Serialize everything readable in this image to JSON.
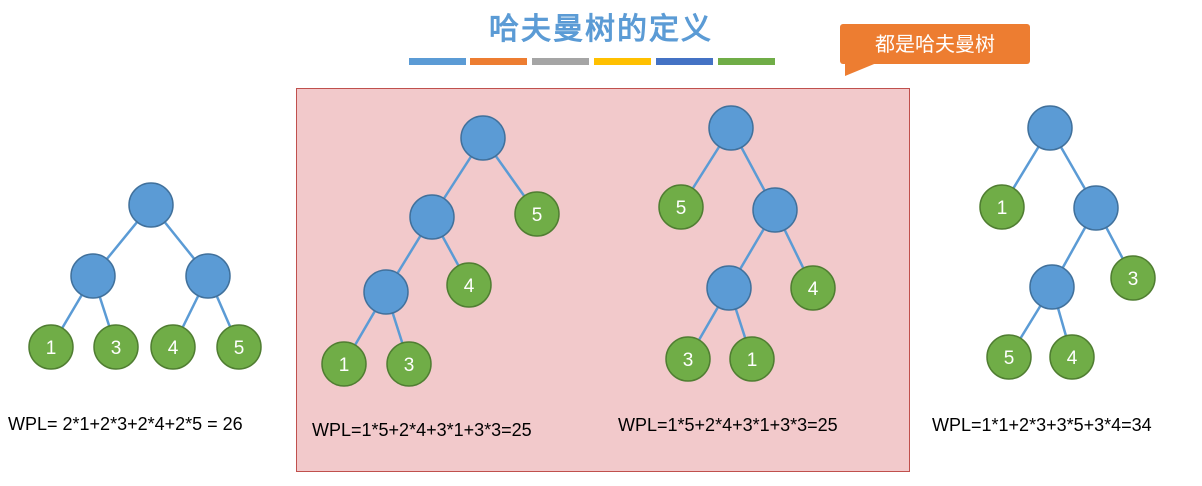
{
  "title": "哈夫曼树的定义",
  "color_bars": [
    "#5b9bd5",
    "#ed7d31",
    "#a5a5a5",
    "#ffc000",
    "#4472c4",
    "#70ad47"
  ],
  "callout": "都是哈夫曼树",
  "colors": {
    "internal_node": "#5b9bd5",
    "leaf_node": "#70ad47",
    "edge": "#5b9bd5",
    "highlight_fill": "#f2c9cb"
  },
  "trees": [
    {
      "leaves": [
        "1",
        "3",
        "4",
        "5"
      ],
      "wpl": "WPL= 2*1+2*3+2*4+2*5 = 26"
    },
    {
      "leaves": [
        "5",
        "4",
        "1",
        "3"
      ],
      "wpl": "WPL=1*5+2*4+3*1+3*3=25"
    },
    {
      "leaves": [
        "5",
        "4",
        "3",
        "1"
      ],
      "wpl": "WPL=1*5+2*4+3*1+3*3=25"
    },
    {
      "leaves": [
        "1",
        "3",
        "5",
        "4"
      ],
      "wpl": "WPL=1*1+2*3+3*5+3*4=34"
    }
  ]
}
